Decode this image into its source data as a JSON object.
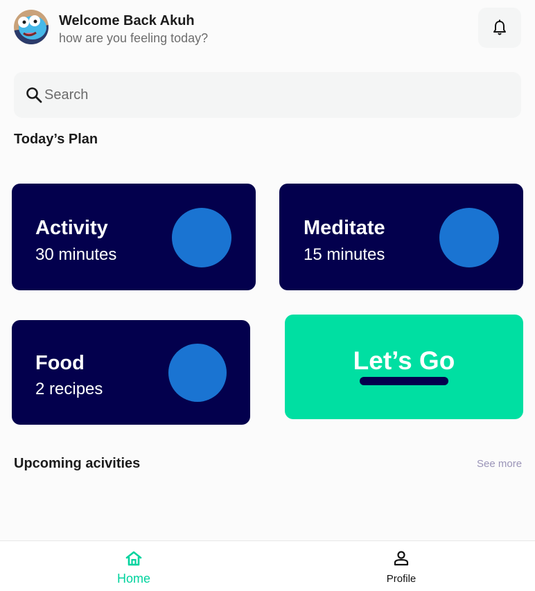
{
  "header": {
    "welcome": "Welcome Back Akuh",
    "subtitle": "how are you feeling today?"
  },
  "search": {
    "placeholder": "Search"
  },
  "plan": {
    "title": "Today’s Plan",
    "cards": [
      {
        "title": "Activity",
        "subtitle": "30 minutes"
      },
      {
        "title": "Meditate",
        "subtitle": "15 minutes"
      },
      {
        "title": "Food",
        "subtitle": "2 recipes"
      }
    ],
    "cta": "Let’s Go"
  },
  "upcoming": {
    "title": "Upcoming acivities",
    "see_more": "See more"
  },
  "nav": {
    "items": [
      {
        "label": "Home",
        "icon": "home-icon",
        "active": true
      },
      {
        "label": "Profile",
        "icon": "person-icon",
        "active": false
      }
    ]
  },
  "colors": {
    "card": "#03004d",
    "accent": "#00dfa2",
    "circle": "#1a74d2"
  }
}
